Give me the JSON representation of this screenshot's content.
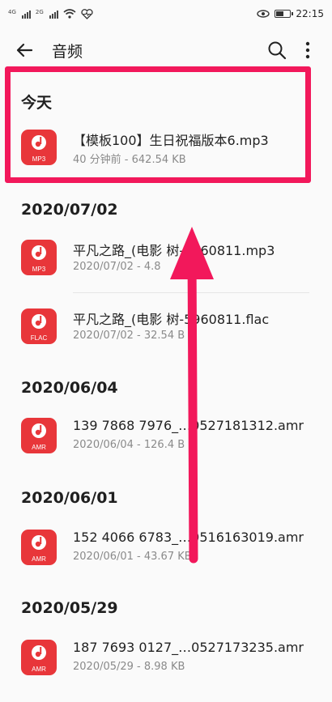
{
  "status_bar": {
    "left_indicators": [
      "4G",
      "2G"
    ],
    "time": "22:15",
    "battery_level": 0.5
  },
  "header": {
    "title": "音频",
    "back_icon": "arrow-left-icon",
    "search_icon": "search-icon",
    "more_icon": "more-vert-icon"
  },
  "sections": [
    {
      "label": "今天",
      "items": [
        {
          "name": "【模板100】生日祝福版本6.mp3",
          "meta": "40 分钟前 - 642.54 KB",
          "ext": "MP3"
        }
      ]
    },
    {
      "label": "2020/07/02",
      "items": [
        {
          "name": "平凡之路_(电影 树-5960811.mp3",
          "meta": "2020/07/02 - 4.8",
          "ext": "MP3"
        },
        {
          "name": "平凡之路_(电影 树-5960811.flac",
          "meta": "2020/07/02 - 32.54 B",
          "ext": "FLAC"
        }
      ]
    },
    {
      "label": "2020/06/04",
      "items": [
        {
          "name": "139 7868 7976_…0527181312.amr",
          "meta": "2020/06/04 - 126.4 B",
          "ext": "AMR"
        }
      ]
    },
    {
      "label": "2020/06/01",
      "items": [
        {
          "name": "152 4066 6783_…0516163019.amr",
          "meta": "2020/06/01 - 43.67 KB",
          "ext": "AMR"
        }
      ]
    },
    {
      "label": "2020/05/29",
      "items": [
        {
          "name": "187 7693 0127_…0527173235.amr",
          "meta": "2020/05/29 - 8.98 KB",
          "ext": "AMR"
        }
      ]
    }
  ],
  "colors": {
    "accent": "#f2185b",
    "file_icon": "#e8363a"
  }
}
